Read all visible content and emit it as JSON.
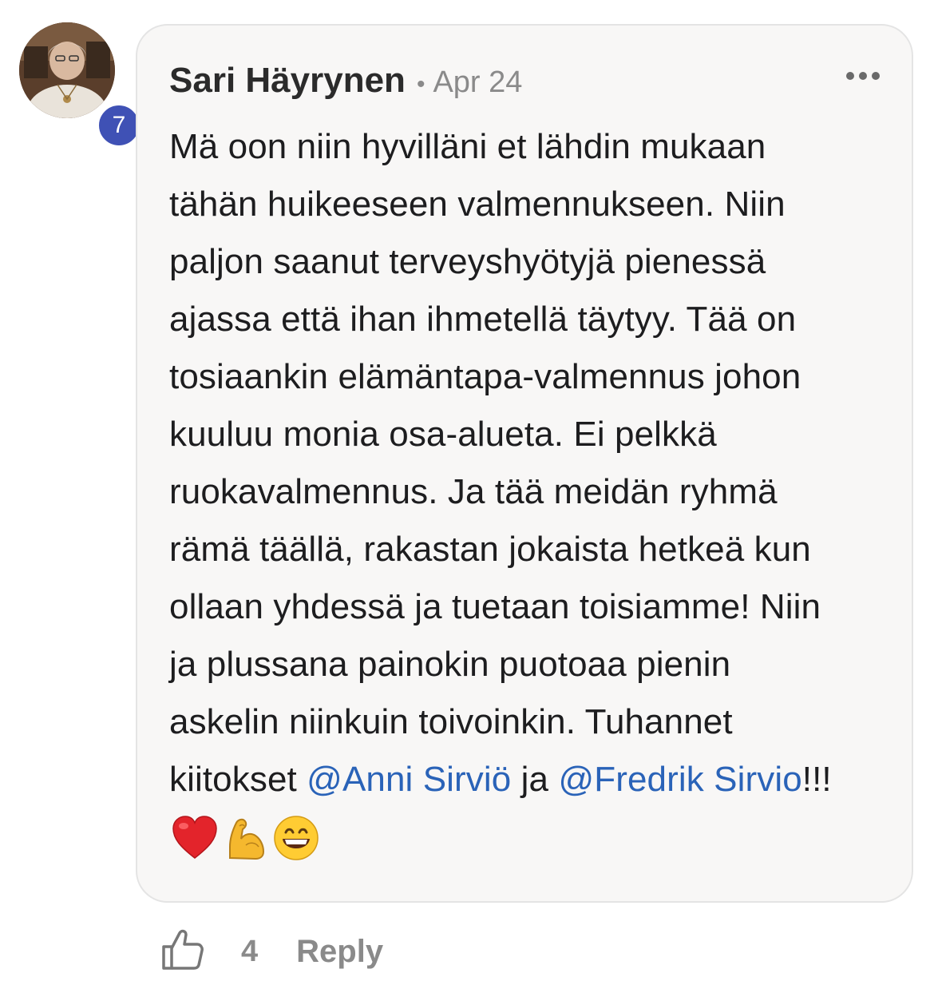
{
  "comment": {
    "author": "Sari Häyrynen",
    "separator": "•",
    "date": "Apr 24",
    "level_badge": "7",
    "more_icon": "ellipsis-horizontal-icon",
    "body_lines": [
      "Mä oon niin hyvilläni et lähdin mukaan",
      "tähän huikeeseen valmennukseen. Niin",
      "paljon saanut terveyshyötyjä pienessä",
      "ajassa että ihan ihmetellä täytyy. Tää on",
      "tosiaankin elämäntapa-valmennus johon",
      "kuuluu monia osa-alueta. Ei pelkkä",
      "ruokavalmennus. Ja tää meidän ryhmä",
      "rämä täällä, rakastan jokaista hetkeä kun",
      "ollaan yhdessä ja tuetaan toisiamme! Niin",
      "ja plussana painokin puotoaa pienin",
      "askelin niinkuin toivoinkin. Tuhannet"
    ],
    "last_line": {
      "prefix": "kiitokset ",
      "mention_1": "@Anni Sirviö",
      "middle": " ja ",
      "mention_2": "@Fredrik Sirvio",
      "suffix": "!!!"
    },
    "emojis": [
      "red-heart",
      "flexed-biceps",
      "grinning-face-with-smiling-eyes"
    ]
  },
  "actions": {
    "like_icon": "thumbs-up-outline-icon",
    "like_count": "4",
    "reply_label": "Reply"
  },
  "colors": {
    "mention": "#2a63b8",
    "badge": "#3f51b5",
    "bubble_bg": "#f8f7f6",
    "muted": "#8a8a8a"
  }
}
